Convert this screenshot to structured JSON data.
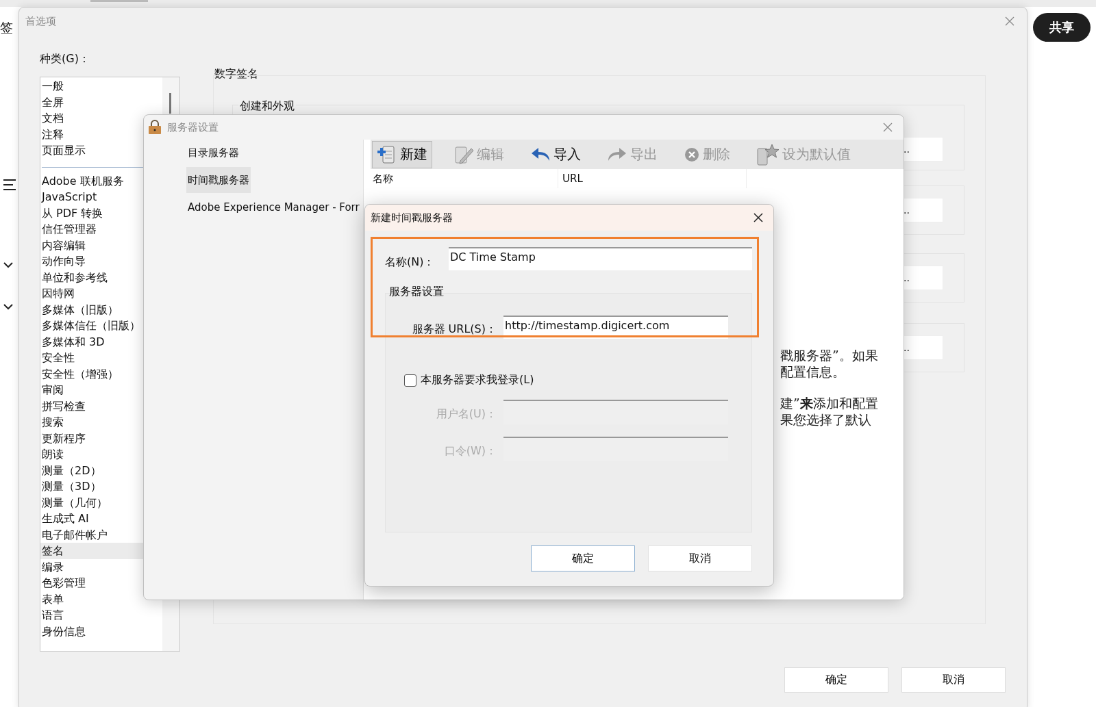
{
  "background_app": {
    "side_label": "签",
    "share_button": "共享"
  },
  "preferences": {
    "title": "首选项",
    "category_label": "种类(G)：",
    "categories_top": [
      {
        "label": "一般",
        "selected": false
      },
      {
        "label": "全屏",
        "selected": false
      },
      {
        "label": "文档",
        "selected": false
      },
      {
        "label": "注释",
        "selected": false
      },
      {
        "label": "页面显示",
        "selected": false
      }
    ],
    "categories": [
      {
        "label": "Adobe 联机服务",
        "selected": false
      },
      {
        "label": "JavaScript",
        "selected": false
      },
      {
        "label": "从 PDF 转换",
        "selected": false
      },
      {
        "label": "信任管理器",
        "selected": false
      },
      {
        "label": "内容编辑",
        "selected": false
      },
      {
        "label": "动作向导",
        "selected": false
      },
      {
        "label": "单位和参考线",
        "selected": false
      },
      {
        "label": "因特网",
        "selected": false
      },
      {
        "label": "多媒体（旧版）",
        "selected": false
      },
      {
        "label": "多媒体信任（旧版）",
        "selected": false
      },
      {
        "label": "多媒体和 3D",
        "selected": false
      },
      {
        "label": "安全性",
        "selected": false
      },
      {
        "label": "安全性（增强）",
        "selected": false
      },
      {
        "label": "审阅",
        "selected": false
      },
      {
        "label": "拼写检查",
        "selected": false
      },
      {
        "label": "搜索",
        "selected": false
      },
      {
        "label": "更新程序",
        "selected": false
      },
      {
        "label": "朗读",
        "selected": false
      },
      {
        "label": "测量（2D）",
        "selected": false
      },
      {
        "label": "测量（3D）",
        "selected": false
      },
      {
        "label": "测量（几何）",
        "selected": false
      },
      {
        "label": "生成式 AI",
        "selected": false
      },
      {
        "label": "电子邮件帐户",
        "selected": false
      },
      {
        "label": "签名",
        "selected": true
      },
      {
        "label": "编录",
        "selected": false
      },
      {
        "label": "色彩管理",
        "selected": false
      },
      {
        "label": "表单",
        "selected": false
      },
      {
        "label": "语言",
        "selected": false
      },
      {
        "label": "身份信息",
        "selected": false
      }
    ],
    "section_title": "数字签名",
    "subsections": [
      {
        "title": "创建和外观",
        "button": ".."
      },
      {
        "button": ".."
      },
      {
        "button": ".."
      },
      {
        "button": ".."
      }
    ],
    "buttons": [
      "确定",
      "取消"
    ]
  },
  "server_settings": {
    "title": "服务器设置",
    "nav": [
      {
        "label": "目录服务器",
        "selected": false
      },
      {
        "label": "时间戳服务器",
        "selected": true
      },
      {
        "label": "Adobe Experience Manager - Forr",
        "selected": false
      }
    ],
    "toolbar": [
      {
        "kind": "new",
        "label": "新建",
        "disabled": false,
        "highlighted": true
      },
      {
        "kind": "edit",
        "label": "编辑",
        "disabled": true,
        "highlighted": false
      },
      {
        "kind": "import",
        "label": "导入",
        "disabled": false,
        "highlighted": false
      },
      {
        "kind": "export",
        "label": "导出",
        "disabled": true,
        "highlighted": false
      },
      {
        "kind": "delete",
        "label": "删除",
        "disabled": true,
        "highlighted": false
      },
      {
        "kind": "default",
        "label": "设为默认值",
        "disabled": true,
        "highlighted": false
      }
    ],
    "columns": [
      "名称",
      "URL"
    ],
    "help_paragraphs": [
      [
        "戳服务器”。如果",
        "配置信息。"
      ],
      [
        "建”**来**添加和配置",
        "果您选择了默认"
      ]
    ]
  },
  "new_timestamp_server": {
    "title": "新建时间戳服务器",
    "name_label": "名称(N)：",
    "name_value": "DC Time Stamp",
    "group_label": "服务器设置",
    "url_label": "服务器 URL(S)：",
    "url_value": "http://timestamp.digicert.com",
    "login_checkbox": {
      "label": "本服务器要求我登录(L)",
      "checked": false
    },
    "username_label": "用户名(U)：",
    "password_label": "口令(W)：",
    "buttons": [
      "确定",
      "取消"
    ]
  }
}
